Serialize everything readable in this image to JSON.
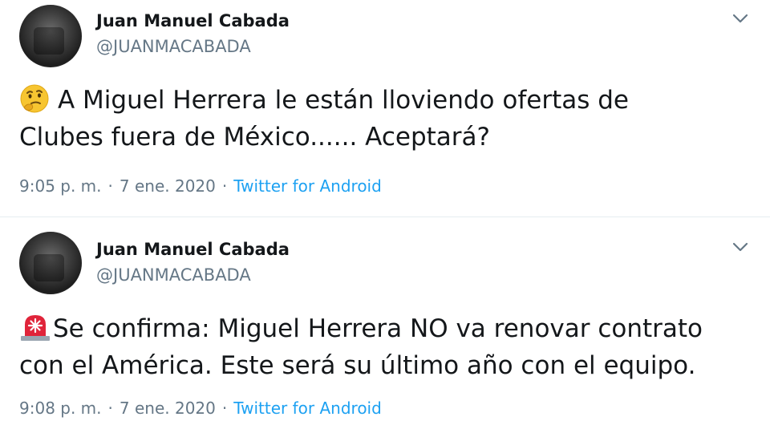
{
  "tweets": [
    {
      "author": "Juan Manuel Cabada",
      "handle": "@JUANMACABADA",
      "emoji_icon": "thinking-face-icon",
      "text_line1": "A Miguel Herrera le están lloviendo ofertas de",
      "text_line2": "Clubes fuera de México...... Aceptará?",
      "time": "9:05 p. m.",
      "date": "7 ene. 2020",
      "separator": "·",
      "source": "Twitter for Android"
    },
    {
      "author": "Juan Manuel Cabada",
      "handle": "@JUANMACABADA",
      "emoji_icon": "siren-icon",
      "text_line1": "Se confirma: Miguel Herrera NO va renovar contrato",
      "text_line2": "con el América. Este será su último año con el equipo.",
      "time": "9:08 p. m.",
      "date": "7 ene. 2020",
      "separator": "·",
      "source": "Twitter for Android"
    }
  ],
  "colors": {
    "text": "#14171a",
    "secondary": "#657786",
    "link": "#1da1f2",
    "divider": "#e6ecf0"
  }
}
